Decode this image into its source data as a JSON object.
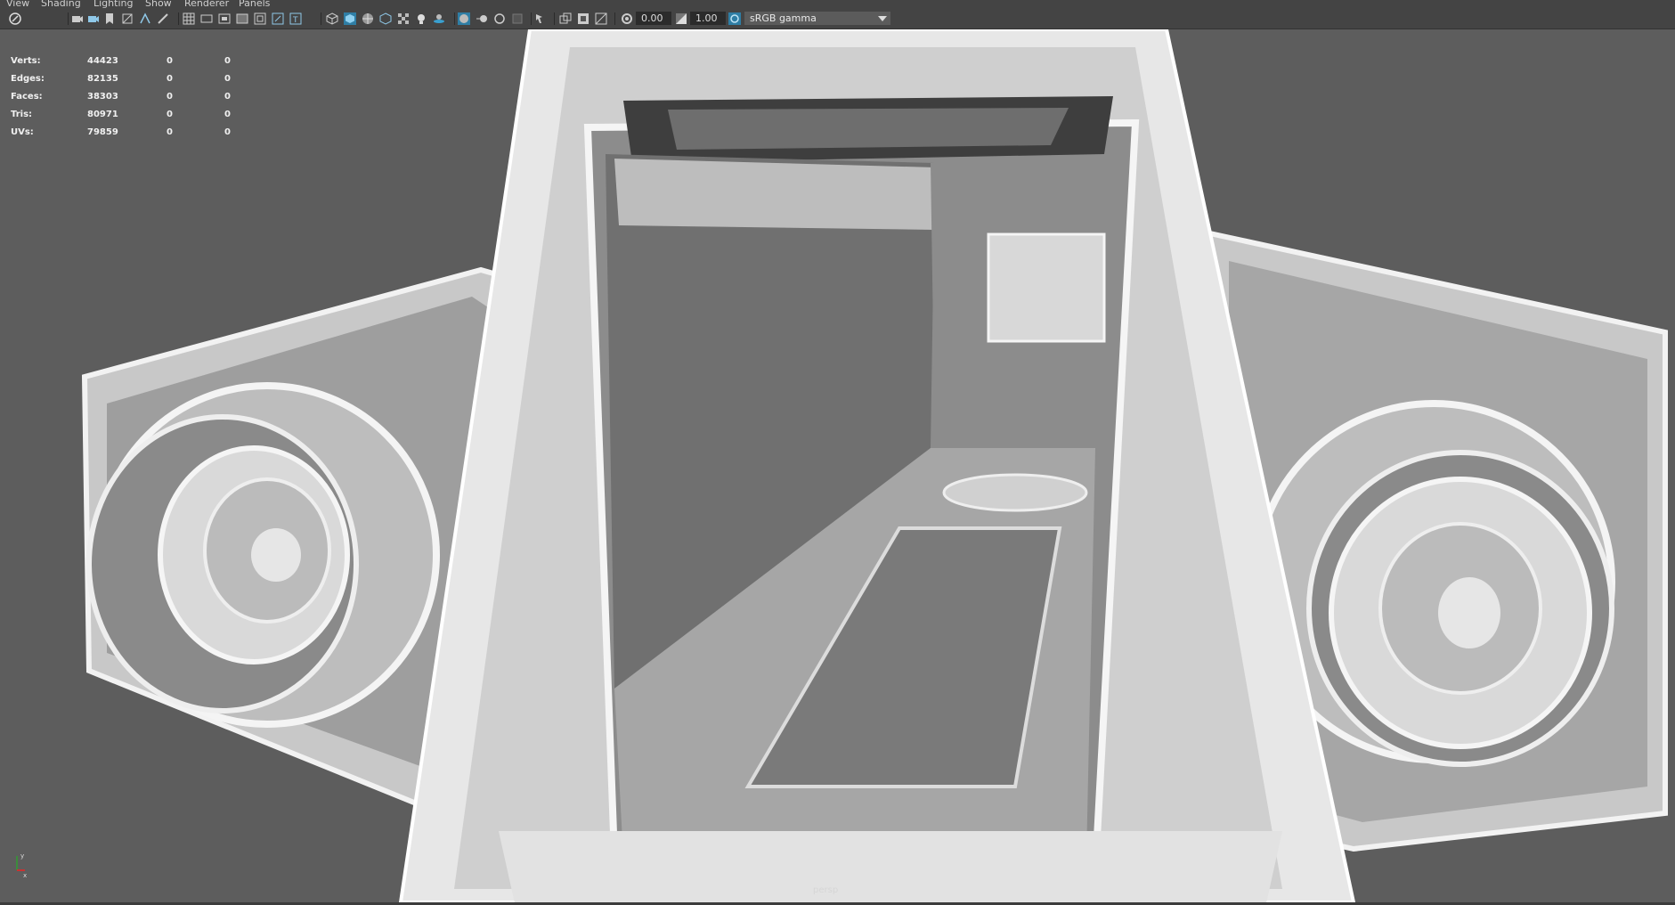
{
  "menu": [
    "View",
    "Shading",
    "Lighting",
    "Show",
    "Renderer",
    "Panels"
  ],
  "toolbar": {
    "exposure_value": "0.00",
    "gamma_value": "1.00",
    "color_management": "sRGB gamma",
    "icons": [
      "select-camera-icon",
      "camera-attributes-icon",
      "bookmark-icon",
      "grid-icon",
      "film-gate-icon",
      "resolution-gate-icon",
      "safe-area-icon",
      "wireframe-icon",
      "smooth-shade-icon",
      "textured-icon",
      "use-lights-icon",
      "shadows-icon",
      "ambient-occlusion-icon",
      "isolate-select-icon",
      "xray-icon",
      "exposure-icon",
      "gamma-icon",
      "color-management-icon"
    ]
  },
  "hud": {
    "rows": [
      {
        "label": "Verts:",
        "value": "44423",
        "a": "0",
        "b": "0"
      },
      {
        "label": "Edges:",
        "value": "82135",
        "a": "0",
        "b": "0"
      },
      {
        "label": "Faces:",
        "value": "38303",
        "a": "0",
        "b": "0"
      },
      {
        "label": "Tris:",
        "value": "80971",
        "a": "0",
        "b": "0"
      },
      {
        "label": "UVs:",
        "value": "79859",
        "a": "0",
        "b": "0"
      }
    ]
  },
  "viewport": {
    "camera": "persp",
    "axis_labels": [
      "x",
      "y"
    ]
  },
  "colors": {
    "background": "#5d5d5d",
    "toolbar": "#444444",
    "model_light": "#e8e8e8",
    "model_mid": "#a9a9a9",
    "model_dark": "#6e6e6e",
    "accent_blue": "#3aa0d0"
  }
}
